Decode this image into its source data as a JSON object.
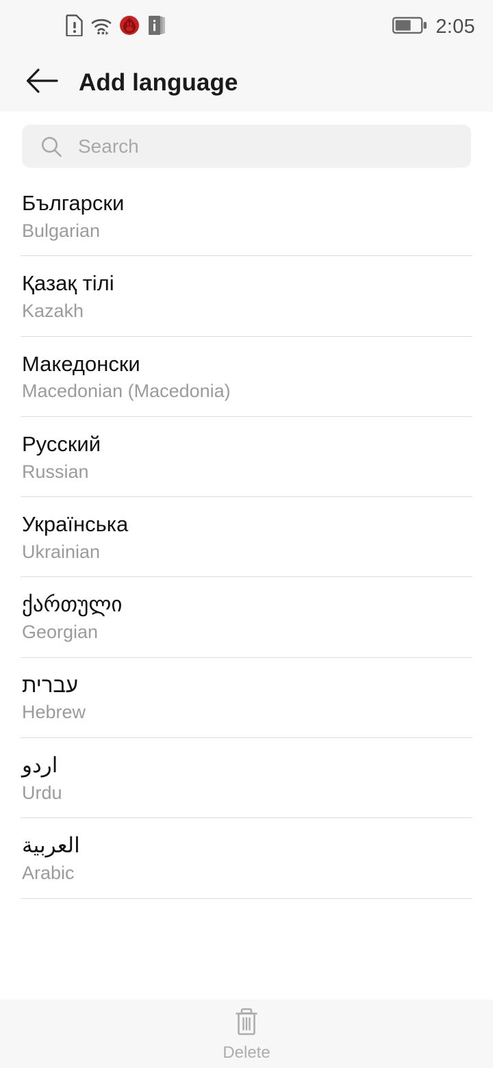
{
  "status_bar": {
    "icons": [
      {
        "name": "sim-card-alert-icon",
        "glyph": "sim-alert"
      },
      {
        "name": "wifi-icon",
        "glyph": "wifi"
      },
      {
        "name": "app-notification-icon",
        "glyph": "red-flame-badge"
      },
      {
        "name": "info-cards-icon",
        "glyph": "info-square"
      }
    ],
    "battery": {
      "name": "battery-icon",
      "level_percent": 60
    },
    "time": "2:05"
  },
  "header": {
    "back_icon": "arrow-left-icon",
    "title": "Add language"
  },
  "search": {
    "icon": "search-icon",
    "placeholder": "Search",
    "value": ""
  },
  "languages": [
    {
      "native": "Български",
      "english": "Bulgarian",
      "rtl": false
    },
    {
      "native": "Қазақ тілі",
      "english": "Kazakh",
      "rtl": false
    },
    {
      "native": "Македонски",
      "english": "Macedonian (Macedonia)",
      "rtl": false
    },
    {
      "native": "Русский",
      "english": "Russian",
      "rtl": false
    },
    {
      "native": "Українська",
      "english": "Ukrainian",
      "rtl": false
    },
    {
      "native": "ქართული",
      "english": "Georgian",
      "rtl": false
    },
    {
      "native": "עברית",
      "english": "Hebrew",
      "rtl": true
    },
    {
      "native": "اردو",
      "english": "Urdu",
      "rtl": true
    },
    {
      "native": "العربية",
      "english": "Arabic",
      "rtl": true
    }
  ],
  "bottom_bar": {
    "delete": {
      "icon": "trash-icon",
      "label": "Delete",
      "enabled": false
    }
  },
  "colors": {
    "chrome_background": "#f7f7f7",
    "content_background": "#ffffff",
    "search_field": "#f1f1f1",
    "primary_text": "#111111",
    "secondary_text": "#9b9b9b",
    "divider": "#dcdcdc",
    "disabled": "#adadad",
    "notification_accent": "#cc2222"
  }
}
